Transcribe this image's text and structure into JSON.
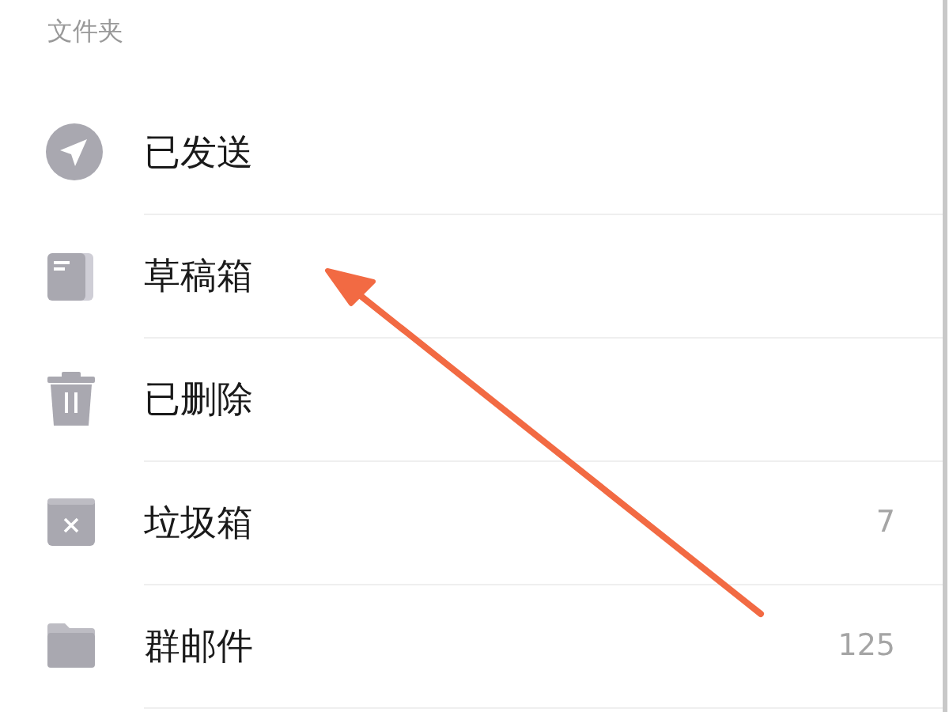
{
  "section_title": "文件夹",
  "folders": [
    {
      "kind": "sent",
      "label": "已发送"
    },
    {
      "kind": "drafts",
      "label": "草稿箱"
    },
    {
      "kind": "deleted",
      "label": "已删除"
    },
    {
      "kind": "spam",
      "label": "垃圾箱",
      "count": "7"
    },
    {
      "kind": "group",
      "label": "群邮件",
      "count": "125"
    }
  ]
}
